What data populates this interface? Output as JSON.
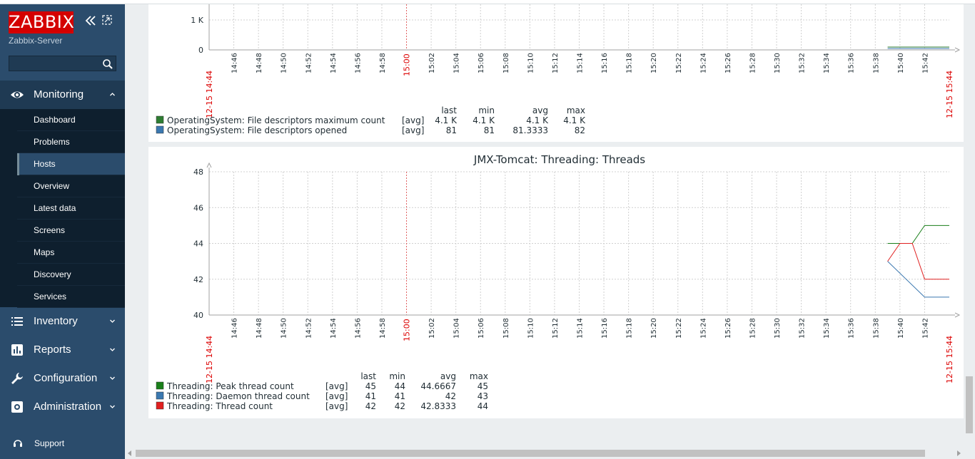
{
  "sidebar": {
    "logo_text": "ZABBIX",
    "server_name": "Zabbix-Server",
    "search": {
      "value": "",
      "placeholder": ""
    },
    "sections": {
      "monitoring": "Monitoring",
      "inventory": "Inventory",
      "reports": "Reports",
      "configuration": "Configuration",
      "administration": "Administration"
    },
    "monitoring_items": [
      "Dashboard",
      "Problems",
      "Hosts",
      "Overview",
      "Latest data",
      "Screens",
      "Maps",
      "Discovery",
      "Services"
    ],
    "active_item": "Hosts",
    "support": "Support",
    "colors": {
      "sidebar_bg": "#2b4c6c",
      "logo_bg": "#d40000"
    }
  },
  "chart_data": [
    {
      "type": "line",
      "title": "",
      "y_ticks": [
        "0",
        "1 K"
      ],
      "x_ticks": [
        "14:46",
        "14:48",
        "14:50",
        "14:52",
        "14:54",
        "14:56",
        "14:58",
        "15:00",
        "15:02",
        "15:04",
        "15:06",
        "15:08",
        "15:10",
        "15:12",
        "15:14",
        "15:16",
        "15:18",
        "15:20",
        "15:22",
        "15:24",
        "15:26",
        "15:28",
        "15:30",
        "15:32",
        "15:34",
        "15:36",
        "15:38",
        "15:40",
        "15:42"
      ],
      "x_start_label": "12-15 14:44",
      "x_end_label": "12-15 15:44",
      "highlight_tick": "15:00",
      "legend_headers": [
        "last",
        "min",
        "avg",
        "max"
      ],
      "series": [
        {
          "name": "OperatingSystem: File descriptors maximum count",
          "func": "[avg]",
          "color": "#2e7d32",
          "last": "4.1 K",
          "min": "4.1 K",
          "avg": "4.1 K",
          "max": "4.1 K"
        },
        {
          "name": "OperatingSystem: File descriptors opened",
          "func": "[avg]",
          "color": "#3b78b0",
          "last": "81",
          "min": "81",
          "avg": "81.3333",
          "max": "82"
        }
      ]
    },
    {
      "type": "line",
      "title": "JMX-Tomcat: Threading: Threads",
      "ylim": [
        40,
        48
      ],
      "y_ticks": [
        "40",
        "42",
        "44",
        "46",
        "48"
      ],
      "x_ticks": [
        "14:46",
        "14:48",
        "14:50",
        "14:52",
        "14:54",
        "14:56",
        "14:58",
        "15:00",
        "15:02",
        "15:04",
        "15:06",
        "15:08",
        "15:10",
        "15:12",
        "15:14",
        "15:16",
        "15:18",
        "15:20",
        "15:22",
        "15:24",
        "15:26",
        "15:28",
        "15:30",
        "15:32",
        "15:34",
        "15:36",
        "15:38",
        "15:40",
        "15:42"
      ],
      "x_start_label": "12-15 14:44",
      "x_end_label": "12-15 15:44",
      "highlight_tick": "15:00",
      "legend_headers": [
        "last",
        "min",
        "avg",
        "max"
      ],
      "series": [
        {
          "name": "Threading: Peak thread count",
          "func": "[avg]",
          "color": "#1a7f1a",
          "last": "45",
          "min": "44",
          "avg": "44.6667",
          "max": "45",
          "points": [
            [
              "15:39",
              44
            ],
            [
              "15:41",
              44
            ],
            [
              "15:42",
              45
            ],
            [
              "15:44",
              45
            ]
          ]
        },
        {
          "name": "Threading: Daemon thread count",
          "func": "[avg]",
          "color": "#3b78b0",
          "last": "41",
          "min": "41",
          "avg": "42",
          "max": "43",
          "points": [
            [
              "15:39",
              43
            ],
            [
              "15:42",
              41
            ],
            [
              "15:44",
              41
            ]
          ]
        },
        {
          "name": "Threading: Thread count",
          "func": "[avg]",
          "color": "#e02020",
          "last": "42",
          "min": "42",
          "avg": "42.8333",
          "max": "44",
          "points": [
            [
              "15:39",
              43
            ],
            [
              "15:40",
              44
            ],
            [
              "15:41",
              44
            ],
            [
              "15:42",
              42
            ],
            [
              "15:44",
              42
            ]
          ]
        }
      ]
    }
  ]
}
